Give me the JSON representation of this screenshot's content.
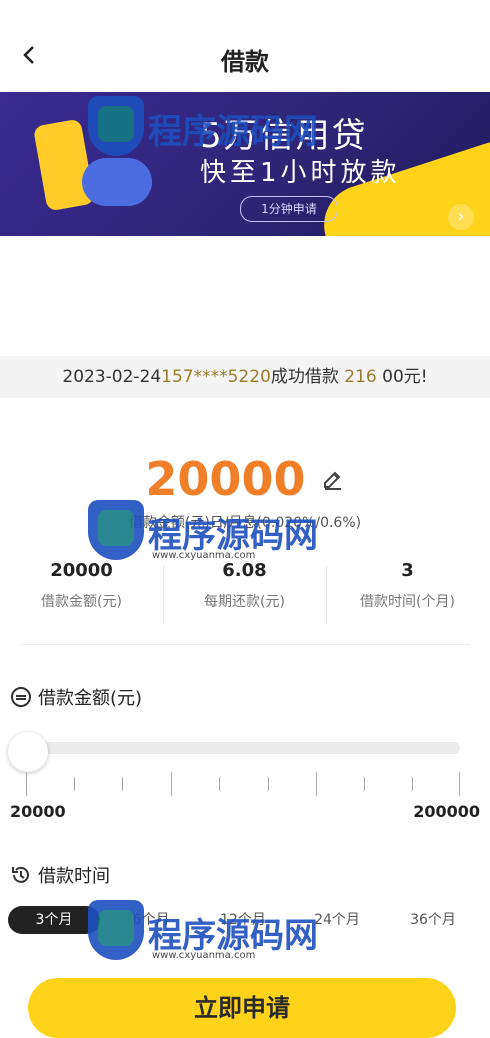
{
  "header": {
    "back_icon": "chevron-left-icon",
    "title": "借款"
  },
  "banner": {
    "headline": "5万信用贷",
    "subline": "快至1小时放款",
    "pill": "1分钟申请"
  },
  "notice": {
    "date": "2023-02-24",
    "phone": "157****5220",
    "mid": "成功借款",
    "amount_part": "216",
    "tail": "00元!"
  },
  "amount": {
    "value": "20000",
    "edit_icon": "edit-icon",
    "rate_text": "借款金额(元)日/月息(0.020%/0.6%)"
  },
  "stats": [
    {
      "value": "20000",
      "label": "借款金额(元)"
    },
    {
      "value": "6.08",
      "label": "每期还款(元)"
    },
    {
      "value": "3",
      "label": "借款时间(个月)"
    }
  ],
  "loan_amount": {
    "label": "借款金额(元)",
    "icon": "coin-icon",
    "min": "20000",
    "max": "200000",
    "fraction": 0.0
  },
  "loan_time": {
    "label": "借款时间",
    "icon": "clock-refresh-icon",
    "tabs": [
      {
        "label": "3个月",
        "active": true
      },
      {
        "label": "6个月"
      },
      {
        "label": "12个月"
      },
      {
        "label": "24个月"
      },
      {
        "label": "36个月"
      }
    ]
  },
  "cta": {
    "label": "立即申请"
  },
  "watermark": {
    "text": "程序源码网",
    "url": "www.cxyuanma.com"
  },
  "colors": {
    "accent": "#f07f2a",
    "button": "#ffd31a",
    "banner": "#2f2577",
    "text": "#222222"
  }
}
